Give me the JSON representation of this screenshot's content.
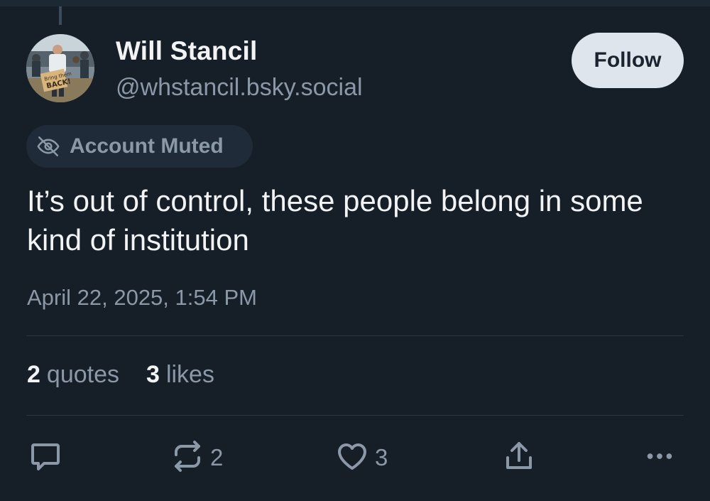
{
  "post": {
    "author": {
      "display_name": "Will Stancil",
      "handle": "@whstancil.bsky.social",
      "avatar_sign_text": "Bring them BACK!"
    },
    "follow_label": "Follow",
    "muted_label": "Account Muted",
    "text": "It’s out of control, these people belong in some kind of institution",
    "timestamp": "April 22, 2025, 1:54 PM"
  },
  "stats": {
    "quotes_count": "2",
    "quotes_label": "quotes",
    "likes_count": "3",
    "likes_label": "likes"
  },
  "actions": {
    "repost_count": "2",
    "like_count": "3"
  },
  "colors": {
    "background": "#161e27",
    "primary_text": "#f1f3f5",
    "secondary_text": "#8a98a8",
    "follow_bg": "#dfe5ec",
    "badge_bg": "#1f2b38",
    "divider": "#2b3744"
  },
  "icons": {
    "reply": "speech-bubble-icon",
    "repost": "repost-arrows-icon",
    "like": "heart-icon",
    "share": "share-upload-icon",
    "more": "ellipsis-icon",
    "muted": "eye-slash-icon"
  }
}
